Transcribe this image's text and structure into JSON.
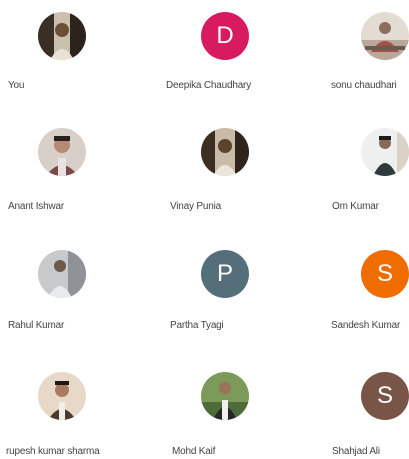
{
  "participants": [
    {
      "name": "You",
      "avatar_type": "photo",
      "photo_tone": "#6b5038"
    },
    {
      "name": "Deepika Chaudhary",
      "avatar_type": "letter",
      "letter": "D",
      "color": "#d81b60"
    },
    {
      "name": "sonu chaudhari",
      "avatar_type": "photo",
      "photo_tone": "#b9a79a"
    },
    {
      "name": "Anant Ishwar",
      "avatar_type": "photo",
      "photo_tone": "#7a4a48"
    },
    {
      "name": "Vinay Punia",
      "avatar_type": "photo",
      "photo_tone": "#5b4330"
    },
    {
      "name": "Om Kumar",
      "avatar_type": "photo",
      "photo_tone": "#2f3b3a"
    },
    {
      "name": "Rahul Kumar",
      "avatar_type": "photo",
      "photo_tone": "#9aa0a4"
    },
    {
      "name": "Partha Tyagi",
      "avatar_type": "letter",
      "letter": "P",
      "color": "#546e7a"
    },
    {
      "name": "Sandesh Kumar",
      "avatar_type": "letter",
      "letter": "S",
      "color": "#ef6c00"
    },
    {
      "name": "rupesh kumar sharma",
      "avatar_type": "photo",
      "photo_tone": "#6b4b35"
    },
    {
      "name": "Mohd Kaif",
      "avatar_type": "photo",
      "photo_tone": "#4f6b3a"
    },
    {
      "name": "Shahjad Ali",
      "avatar_type": "letter",
      "letter": "S",
      "color": "#795548"
    }
  ]
}
